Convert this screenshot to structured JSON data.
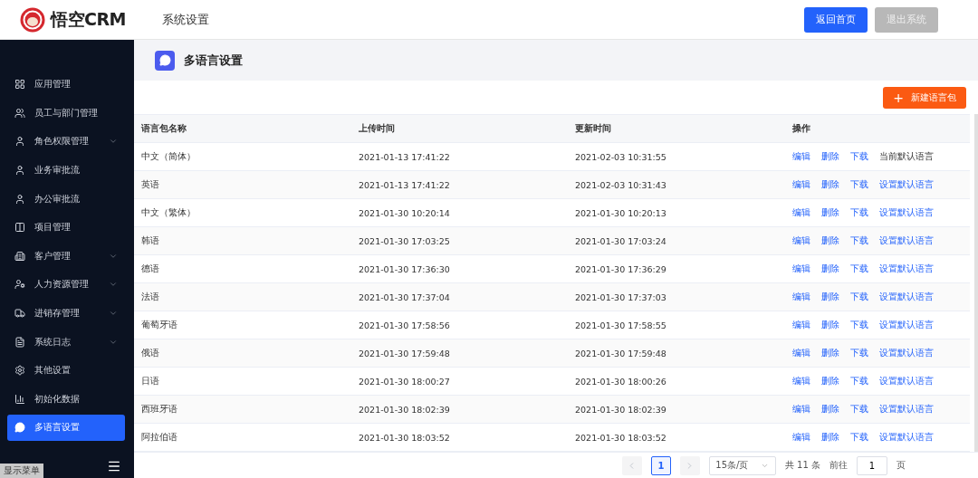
{
  "header": {
    "logo_text": "悟空CRM",
    "section": "系统设置",
    "buttons": [
      {
        "label": "返回首页",
        "kind": "primary"
      },
      {
        "label": "退出系统",
        "kind": "muted"
      }
    ]
  },
  "sidebar": {
    "items": [
      {
        "label": "应用管理",
        "has_submenu": false,
        "selected": false
      },
      {
        "label": "员工与部门管理",
        "has_submenu": false,
        "selected": false
      },
      {
        "label": "角色权限管理",
        "has_submenu": true,
        "selected": false
      },
      {
        "label": "业务审批流",
        "has_submenu": false,
        "selected": false
      },
      {
        "label": "办公审批流",
        "has_submenu": false,
        "selected": false
      },
      {
        "label": "项目管理",
        "has_submenu": false,
        "selected": false
      },
      {
        "label": "客户管理",
        "has_submenu": true,
        "selected": false
      },
      {
        "label": "人力资源管理",
        "has_submenu": true,
        "selected": false
      },
      {
        "label": "进销存管理",
        "has_submenu": true,
        "selected": false
      },
      {
        "label": "系统日志",
        "has_submenu": true,
        "selected": false
      },
      {
        "label": "其他设置",
        "has_submenu": false,
        "selected": false
      },
      {
        "label": "初始化数据",
        "has_submenu": false,
        "selected": false
      },
      {
        "label": "多语言设置",
        "has_submenu": false,
        "selected": true
      }
    ],
    "tooltip": "显示菜单"
  },
  "page_title": "多语言设置",
  "new_button": {
    "icon_char": "+",
    "label": "新建语言包"
  },
  "table": {
    "columns": [
      "语言包名称",
      "上传时间",
      "更新时间",
      "操作"
    ],
    "rows": [
      {
        "name": "中文（简体）",
        "uploaded": "2021-01-13 17:41:22",
        "updated": "2021-02-03 10:31:55",
        "actions": [
          "编辑",
          "删除",
          "下载"
        ],
        "default": {
          "label": "当前默认语言",
          "kind": "text"
        }
      },
      {
        "name": "英语",
        "uploaded": "2021-01-13 17:41:22",
        "updated": "2021-02-03 10:31:43",
        "actions": [
          "编辑",
          "删除",
          "下载"
        ],
        "default": {
          "label": "设置默认语言",
          "kind": "link"
        }
      },
      {
        "name": "中文（繁体）",
        "uploaded": "2021-01-30 10:20:14",
        "updated": "2021-01-30 10:20:13",
        "actions": [
          "编辑",
          "删除",
          "下载"
        ],
        "default": {
          "label": "设置默认语言",
          "kind": "link"
        }
      },
      {
        "name": "韩语",
        "uploaded": "2021-01-30 17:03:25",
        "updated": "2021-01-30 17:03:24",
        "actions": [
          "编辑",
          "删除",
          "下载"
        ],
        "default": {
          "label": "设置默认语言",
          "kind": "link"
        }
      },
      {
        "name": "德语",
        "uploaded": "2021-01-30 17:36:30",
        "updated": "2021-01-30 17:36:29",
        "actions": [
          "编辑",
          "删除",
          "下载"
        ],
        "default": {
          "label": "设置默认语言",
          "kind": "link"
        }
      },
      {
        "name": "法语",
        "uploaded": "2021-01-30 17:37:04",
        "updated": "2021-01-30 17:37:03",
        "actions": [
          "编辑",
          "删除",
          "下载"
        ],
        "default": {
          "label": "设置默认语言",
          "kind": "link"
        }
      },
      {
        "name": "葡萄牙语",
        "uploaded": "2021-01-30 17:58:56",
        "updated": "2021-01-30 17:58:55",
        "actions": [
          "编辑",
          "删除",
          "下载"
        ],
        "default": {
          "label": "设置默认语言",
          "kind": "link"
        }
      },
      {
        "name": "俄语",
        "uploaded": "2021-01-30 17:59:48",
        "updated": "2021-01-30 17:59:48",
        "actions": [
          "编辑",
          "删除",
          "下载"
        ],
        "default": {
          "label": "设置默认语言",
          "kind": "link"
        }
      },
      {
        "name": "日语",
        "uploaded": "2021-01-30 18:00:27",
        "updated": "2021-01-30 18:00:26",
        "actions": [
          "编辑",
          "删除",
          "下载"
        ],
        "default": {
          "label": "设置默认语言",
          "kind": "link"
        }
      },
      {
        "name": "西班牙语",
        "uploaded": "2021-01-30 18:02:39",
        "updated": "2021-01-30 18:02:39",
        "actions": [
          "编辑",
          "删除",
          "下载"
        ],
        "default": {
          "label": "设置默认语言",
          "kind": "link"
        }
      },
      {
        "name": "阿拉伯语",
        "uploaded": "2021-01-30 18:03:52",
        "updated": "2021-01-30 18:03:52",
        "actions": [
          "编辑",
          "删除",
          "下载"
        ],
        "default": {
          "label": "设置默认语言",
          "kind": "link"
        }
      }
    ]
  },
  "pagination": {
    "prev_disabled": true,
    "next_disabled": true,
    "pages": [
      {
        "label": "1",
        "selected": true
      }
    ],
    "page_size": "15条/页",
    "total": "共 11 条",
    "goto_label": "前往",
    "goto_value": "1",
    "goto_suffix": "页"
  }
}
